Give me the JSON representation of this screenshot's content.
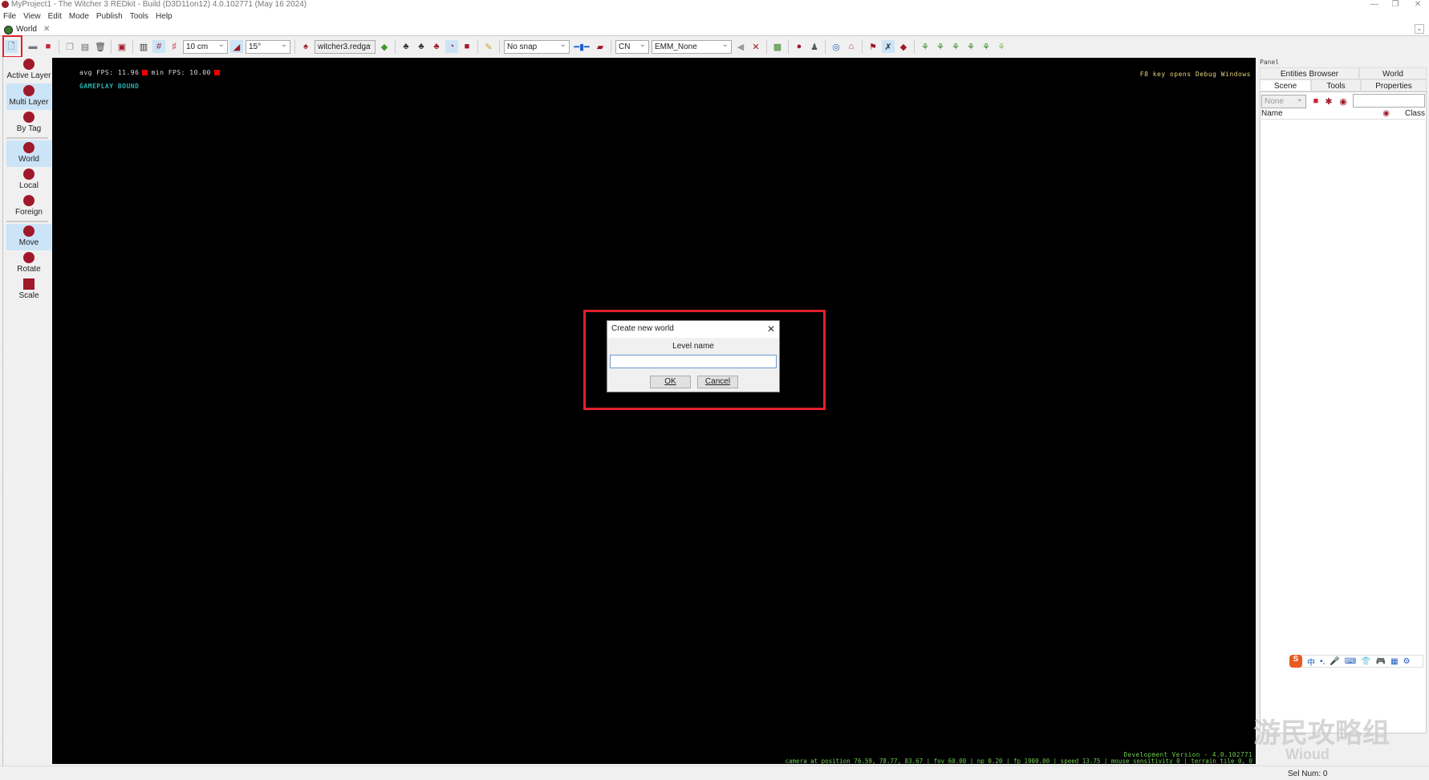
{
  "window": {
    "title": "MyProject1 - The Witcher 3 REDkit - Build  (D3D11on12) 4.0.102771  (May 16 2024)",
    "min": "—",
    "restore": "❐",
    "close": "✕"
  },
  "menu": [
    "File",
    "View",
    "Edit",
    "Mode",
    "Publish",
    "Tools",
    "Help"
  ],
  "doc_tab": {
    "label": "World",
    "close": "✕"
  },
  "toolbar": {
    "grid_size": "10 cm",
    "angle": "15°",
    "preset": "witcher3.redga",
    "snap": "No snap",
    "lang": "CN",
    "emm": "EMM_None"
  },
  "left_tools": [
    {
      "label": "Active Layer",
      "active": false
    },
    {
      "label": "Multi Layer",
      "active": true
    },
    {
      "label": "By Tag",
      "active": false
    },
    {
      "label": "World",
      "active": true
    },
    {
      "label": "Local",
      "active": false
    },
    {
      "label": "Foreign",
      "active": false
    },
    {
      "label": "Move",
      "active": true
    },
    {
      "label": "Rotate",
      "active": false
    },
    {
      "label": "Scale",
      "active": false
    }
  ],
  "viewport": {
    "avg_fps": "avg FPS: 11.96",
    "min_fps": "min FPS: 10.00",
    "gameplay": "GAMEPLAY BOUND",
    "debug_hint": "F8 key opens Debug Windows",
    "version": "Development Version - 4.0.102771",
    "camera": "camera at position 76.59, 78.77, 83.67 | fov 60.00 | np 0.20 | fp 1900.00 | speed 13.75 | mouse sensitivity 0 | terrain tile 0, 0"
  },
  "dialog": {
    "title": "Create new world",
    "label": "Level name",
    "value": "",
    "ok": "OK",
    "cancel": "Cancel",
    "close": "✕"
  },
  "panel": {
    "title": "Panel",
    "tabs_top": [
      "Entities Browser",
      "World"
    ],
    "tabs_bottom": [
      "Scene",
      "Tools",
      "Properties"
    ],
    "filter": "None",
    "col_name": "Name",
    "col_class": "Class"
  },
  "ime": {
    "logo": "S",
    "items": [
      "中",
      "•,",
      "🎤",
      "⌨",
      "👕",
      "🎮",
      "▦",
      "⚙"
    ]
  },
  "watermark": {
    "cn": "游民攻略组",
    "en": "Wioud"
  },
  "status": {
    "sel": "Sel Num: 0"
  },
  "colors": {
    "highlight": "#e0202a",
    "accent": "#a0182a",
    "overlay_green": "#6fcf4f",
    "overlay_cyan": "#2ab0b0"
  }
}
